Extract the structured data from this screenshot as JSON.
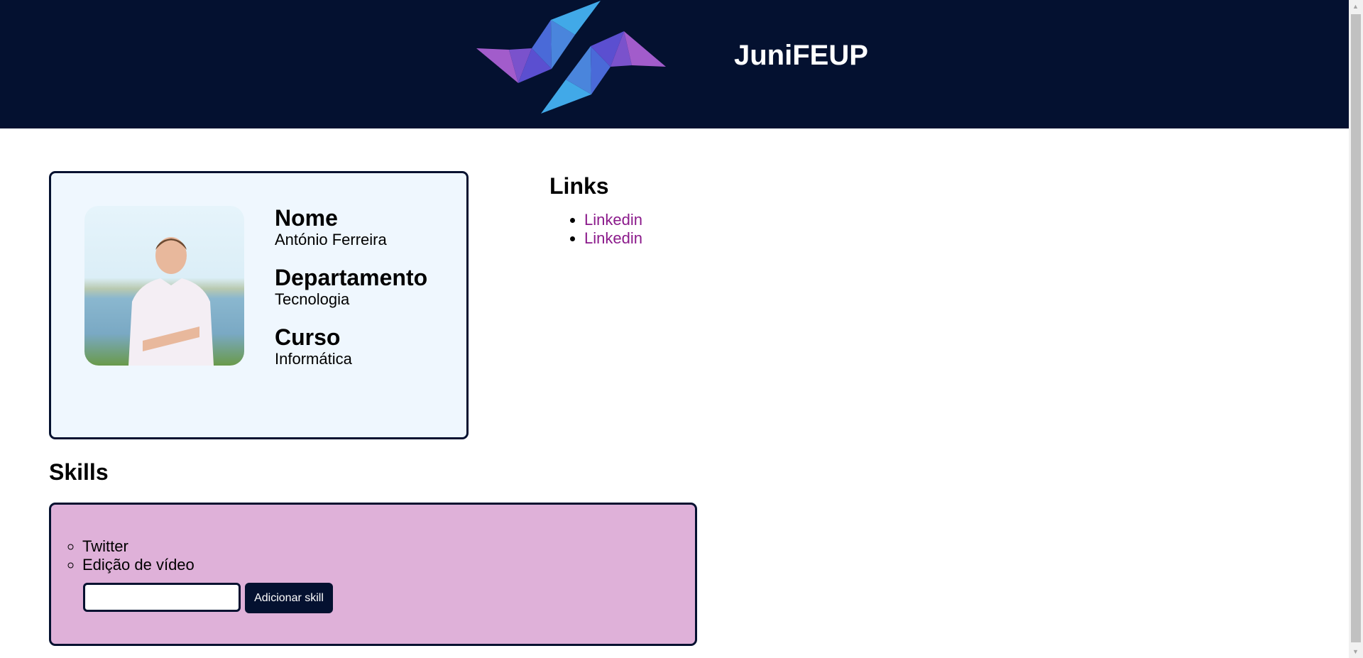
{
  "header": {
    "brand": "JuniFEUP",
    "logo_colors": [
      "#a25ccb",
      "#7a52cc",
      "#5b4fd0",
      "#4a6ad8",
      "#4a85dc",
      "#41a9e8"
    ],
    "background": "#041130"
  },
  "profile": {
    "fields": [
      {
        "label": "Nome",
        "value": "António Ferreira"
      },
      {
        "label": "Departamento",
        "value": "Tecnologia"
      },
      {
        "label": "Curso",
        "value": "Informática"
      }
    ]
  },
  "links": {
    "title": "Links",
    "items": [
      {
        "label": "Linkedin"
      },
      {
        "label": "Linkedin"
      }
    ]
  },
  "skills": {
    "title": "Skills",
    "items": [
      "Twitter",
      "Edição de vídeo"
    ],
    "input_value": "",
    "add_button": "Adicionar skill"
  }
}
